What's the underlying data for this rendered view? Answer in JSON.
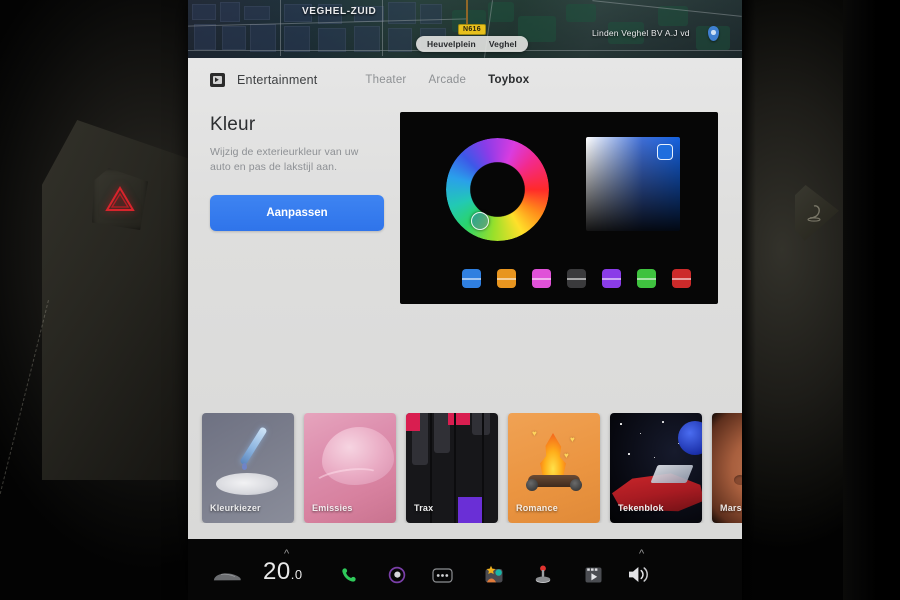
{
  "screen": {
    "map": {
      "area_label": "VEGHEL-ZUID",
      "poi_label": "Linden Veghel BV A.J vd",
      "road_shield": "N616",
      "address_street": "Heuvelplein",
      "address_city": "Veghel"
    },
    "topbar": {
      "app_icon": "film-icon",
      "app_label": "Entertainment",
      "tabs": [
        {
          "label": "Theater",
          "active": false
        },
        {
          "label": "Arcade",
          "active": false
        },
        {
          "label": "Toybox",
          "active": true
        }
      ]
    },
    "panel": {
      "title": "Kleur",
      "description": "Wijzig de exterieurkleur van uw auto en pas de lakstijl aan.",
      "button_label": "Aanpassen"
    },
    "color_picker": {
      "hue_wheel": "hue-ring",
      "sv_square": "saturation-brightness-square",
      "selected_hue_deg": 228,
      "swatches": [
        {
          "name": "blue",
          "hex": "#2f7fe0"
        },
        {
          "name": "orange",
          "hex": "#e8951f"
        },
        {
          "name": "magenta",
          "hex": "#e051d8"
        },
        {
          "name": "gray",
          "hex": "#3a3a3c"
        },
        {
          "name": "purple",
          "hex": "#8a3ce8"
        },
        {
          "name": "green",
          "hex": "#3fc23f"
        },
        {
          "name": "red",
          "hex": "#cc2a2a"
        }
      ]
    },
    "tiles": [
      {
        "label": "Kleurkiezer",
        "art": "paint-dropper"
      },
      {
        "label": "Emissies",
        "art": "pink-whoopee"
      },
      {
        "label": "Trax",
        "art": "piano-keys"
      },
      {
        "label": "Romance",
        "art": "campfire"
      },
      {
        "label": "Tekenblok",
        "art": "roadster-space"
      },
      {
        "label": "Mars",
        "art": "mars-planet"
      }
    ],
    "statusbar": {
      "car_icon": "car-icon",
      "temperature": "20",
      "temperature_decimal": ".0",
      "phone_icon": "phone-icon",
      "media_icon": "media-circle-icon",
      "more_icon": "ellipsis-icon",
      "apps_icon": "apps-icon",
      "arcade_icon": "joystick-icon",
      "theater_icon": "clapper-icon",
      "volume_icon": "speaker-icon"
    }
  },
  "dashboard": {
    "hazard_button": "hazard-triangle-icon",
    "vent_button": "vent-icon"
  },
  "colors": {
    "accent_blue": "#3278ec",
    "screen_bg": "#dedede",
    "panel_black": "#060606"
  }
}
